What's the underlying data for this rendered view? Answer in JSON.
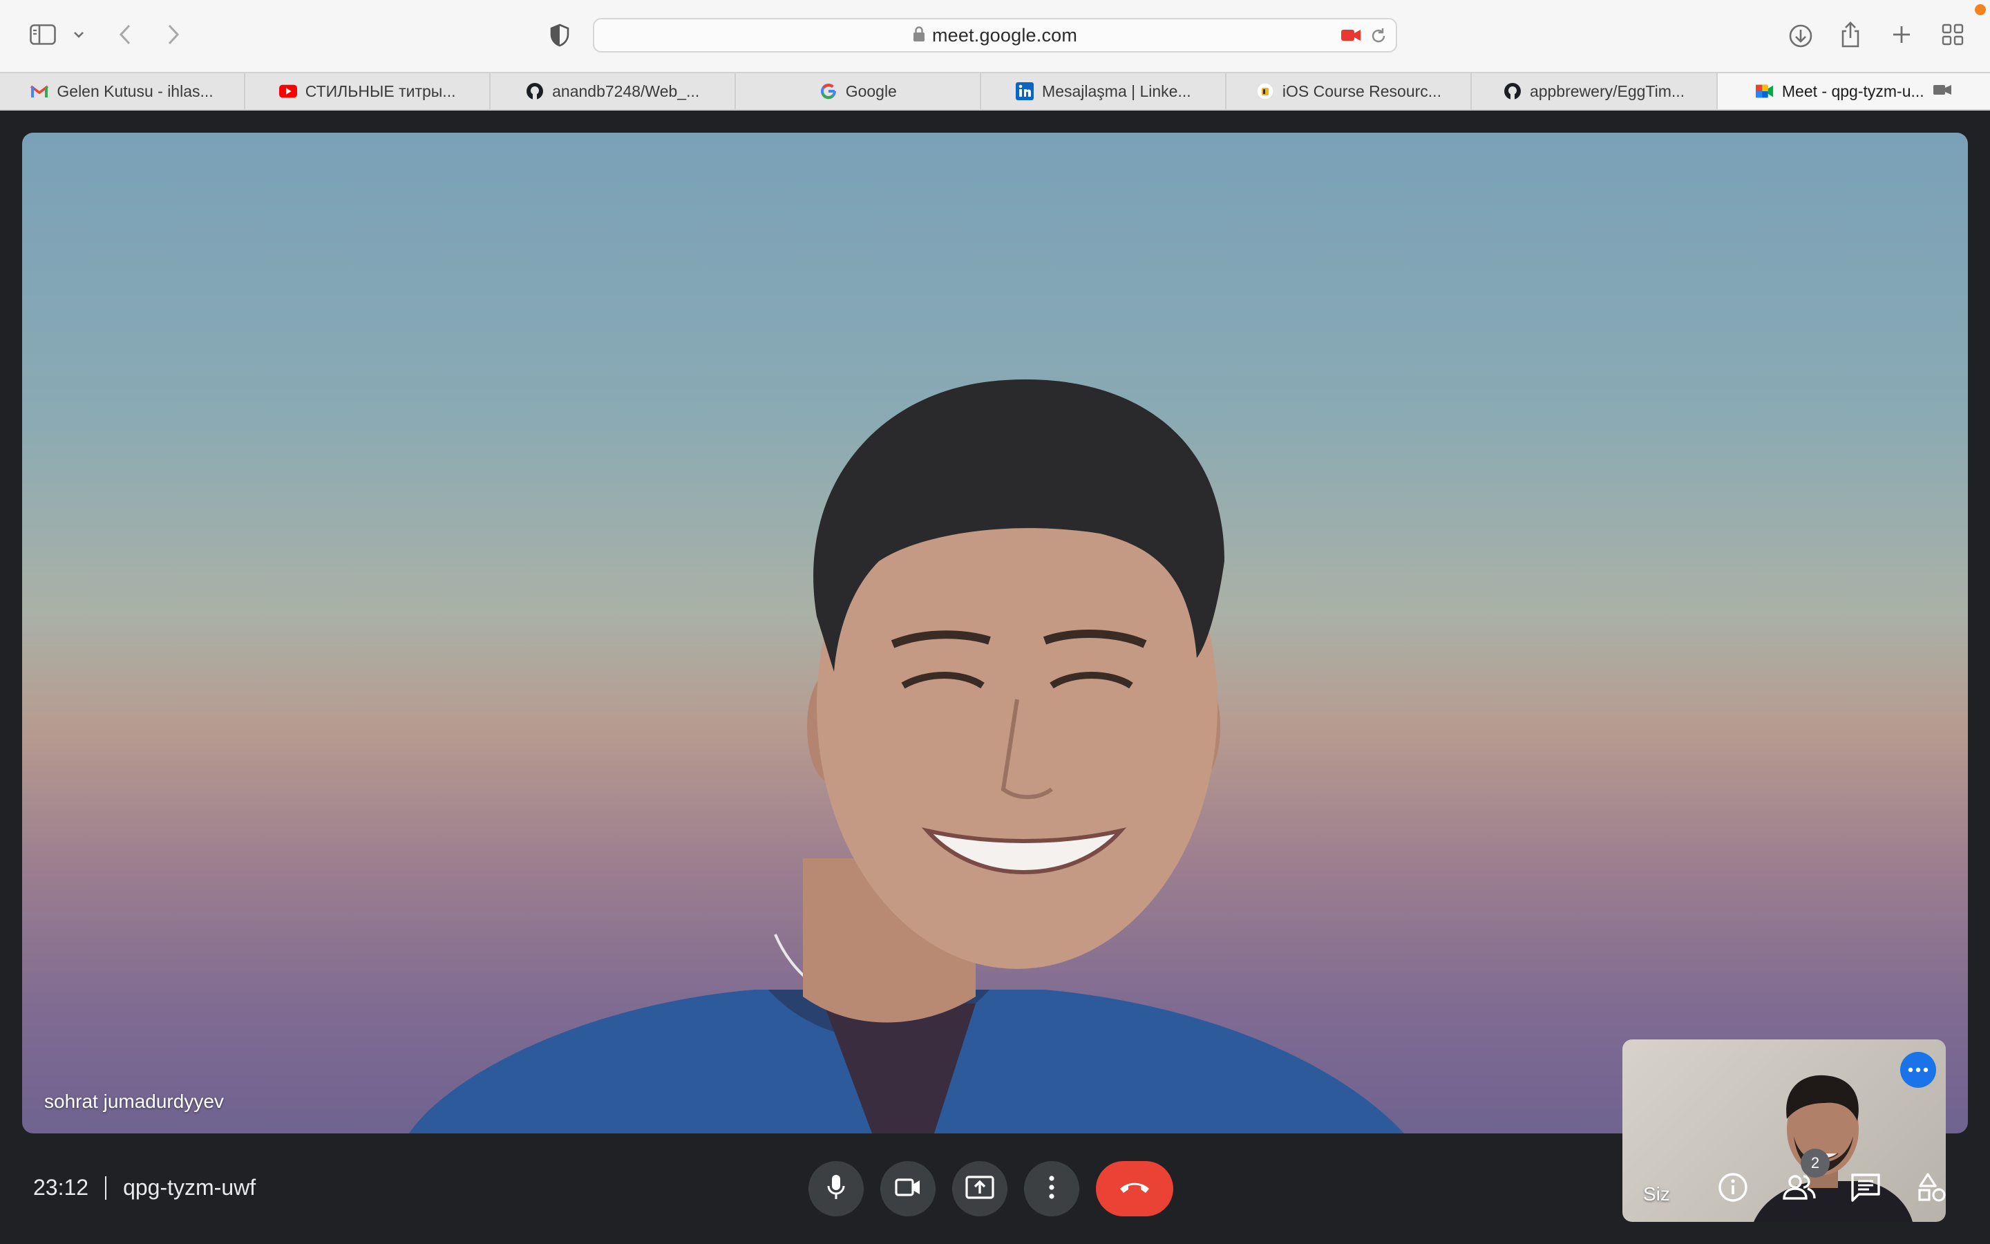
{
  "browser": {
    "url": "meet.google.com",
    "tabs": [
      {
        "label": "Gelen Kutusu - ihlas...",
        "icon": "gmail-icon"
      },
      {
        "label": "СТИЛЬНЫЕ титры...",
        "icon": "youtube-icon"
      },
      {
        "label": "anandb7248/Web_...",
        "icon": "github-icon"
      },
      {
        "label": "Google",
        "icon": "google-icon"
      },
      {
        "label": "Mesajlaşma | Linke...",
        "icon": "linkedin-icon"
      },
      {
        "label": "iOS Course Resourc...",
        "icon": "course-icon"
      },
      {
        "label": "appbrewery/EggTim...",
        "icon": "github-icon"
      },
      {
        "label": "Meet - qpg-tyzm-u...",
        "icon": "meet-icon",
        "active": true
      }
    ]
  },
  "meeting": {
    "main_participant": "sohrat jumadurdyyev",
    "self_label": "Siz",
    "time": "23:12",
    "code": "qpg-tyzm-uwf",
    "participants_count": "2"
  },
  "colors": {
    "hangup": "#ea4335",
    "control_bg": "#3c4043",
    "background": "#202124",
    "accent_blue": "#1a73e8"
  }
}
